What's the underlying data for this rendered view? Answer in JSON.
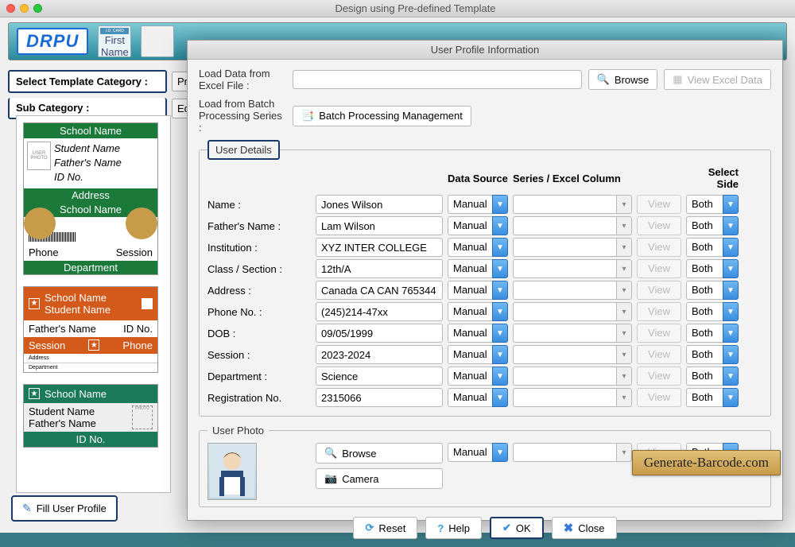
{
  "window": {
    "title": "Design using Pre-defined Template"
  },
  "brand": {
    "logo_text": "DRPU"
  },
  "category": {
    "label_template": "Select Template Category :",
    "label_sub": "Sub Category :",
    "template_value": "Pre",
    "sub_value": "Ed"
  },
  "templates": {
    "t1": {
      "school": "School Name",
      "student": "Student Name",
      "father": "Father's Name",
      "id": "ID No.",
      "address": "Address",
      "phone": "Phone",
      "session": "Session",
      "dept": "Department",
      "photo": "USER PHOTO"
    },
    "t2": {
      "school": "School Name",
      "student": "Student Name",
      "father": "Father's Name",
      "id": "ID No.",
      "session": "Session",
      "phone": "Phone",
      "address": "Address",
      "dept": "Department"
    },
    "t3": {
      "school": "School Name",
      "student": "Student Name",
      "father": "Father's Name",
      "photo": "PHOTO",
      "id": "ID No."
    }
  },
  "fill_profile_btn": "Fill User Profile",
  "dialog": {
    "title": "User Profile Information",
    "load_excel_label": "Load Data from Excel File :",
    "browse": "Browse",
    "view_excel": "View Excel Data",
    "load_batch_label": "Load from Batch Processing Series :",
    "batch_btn": "Batch Processing Management",
    "user_details_legend": "User Details",
    "headers": {
      "data_source": "Data Source",
      "series": "Series / Excel Column",
      "select_side": "Select Side"
    },
    "view_btn": "View",
    "ds_manual": "Manual",
    "side_both": "Both",
    "fields": [
      {
        "label": "Name :",
        "value": "Jones Wilson"
      },
      {
        "label": "Father's Name :",
        "value": "Lam Wilson"
      },
      {
        "label": "Institution :",
        "value": "XYZ INTER COLLEGE"
      },
      {
        "label": "Class / Section :",
        "value": "12th/A"
      },
      {
        "label": "Address :",
        "value": "Canada CA CAN 765344"
      },
      {
        "label": "Phone No. :",
        "value": "(245)214-47xx"
      },
      {
        "label": "DOB :",
        "value": "09/05/1999"
      },
      {
        "label": "Session :",
        "value": "2023-2024"
      },
      {
        "label": "Department :",
        "value": "Science"
      },
      {
        "label": "Registration No.",
        "value": "2315066"
      }
    ],
    "user_photo_legend": "User Photo",
    "camera": "Camera",
    "footer": {
      "reset": "Reset",
      "help": "Help",
      "ok": "OK",
      "close": "Close"
    }
  },
  "watermark": "Generate-Barcode.com"
}
